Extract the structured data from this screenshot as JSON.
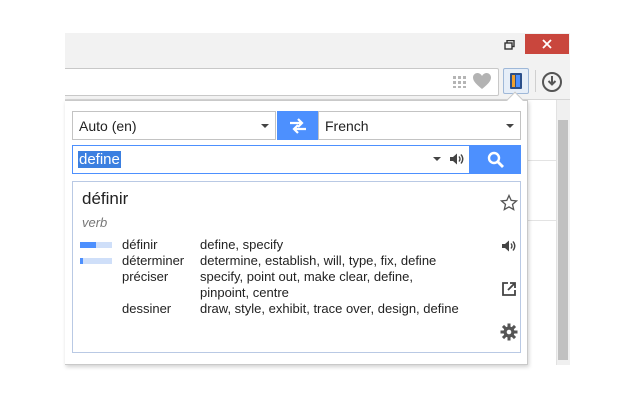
{
  "popup": {
    "source_language": "Auto (en)",
    "target_language": "French",
    "query": "define",
    "result": {
      "headword": "définir",
      "part_of_speech": "verb",
      "translations": [
        {
          "word": "définir",
          "synonyms": "define, specify",
          "frequency": 0.5
        },
        {
          "word": "déterminer",
          "synonyms": "determine, establish, will, type, fix, define",
          "frequency": 0.1
        },
        {
          "word": "préciser",
          "synonyms": "specify, point out, make clear, define, pinpoint, centre",
          "frequency": 0
        },
        {
          "word": "dessiner",
          "synonyms": "draw, style, exhibit, trace over, design, define",
          "frequency": 0
        }
      ]
    }
  },
  "icons": {
    "minimize": "minimize-icon",
    "maximize": "restore-icon",
    "close": "close-icon",
    "swap": "swap-arrows-icon",
    "search": "search-icon",
    "speaker": "speaker-icon",
    "star": "star-icon",
    "open": "open-external-icon",
    "settings": "gear-icon",
    "download": "download-icon"
  },
  "colors": {
    "accent": "#4d90fe",
    "close_button": "#c9463d",
    "selection": "#3b7fe0"
  }
}
